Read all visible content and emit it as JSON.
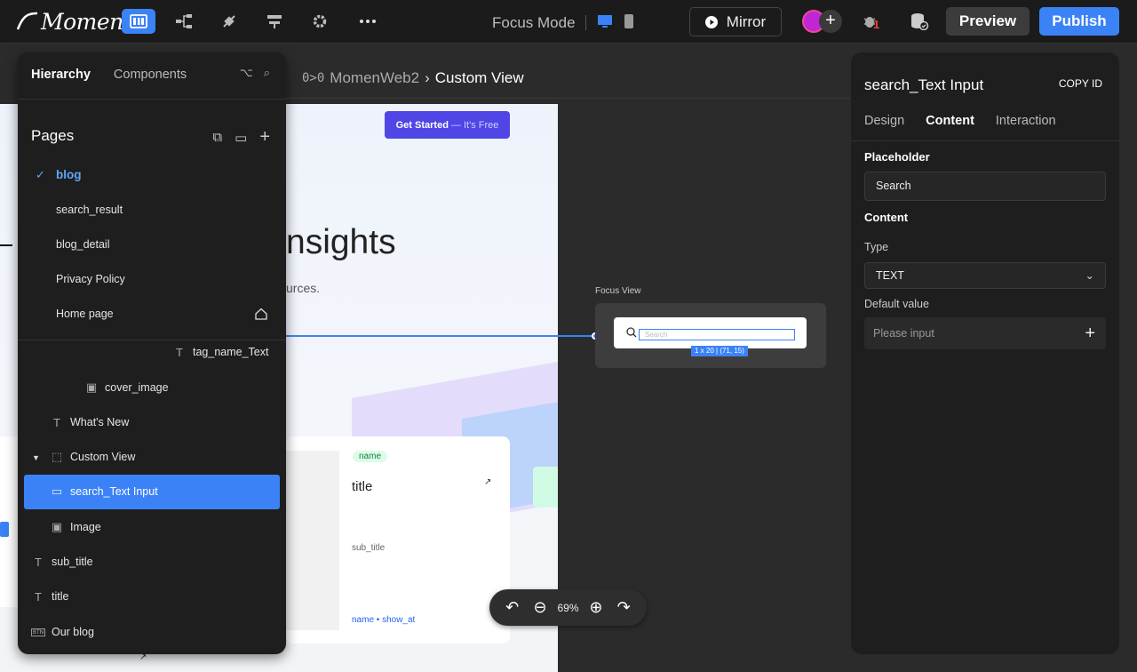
{
  "topbar": {
    "logo": "Momen",
    "focus_mode": "Focus Mode",
    "mirror": "Mirror",
    "bug_count": "1",
    "preview": "Preview",
    "publish": "Publish",
    "accent": "#3b82f6"
  },
  "breadcrumb": {
    "icon": "0>0",
    "app": "MomenWeb2",
    "page": "Custom View"
  },
  "canvas": {
    "get_started": "Get Started",
    "get_started_sub": "— It's Free",
    "hero_title": "nsights",
    "hero_sub": "urces.",
    "card": {
      "badge": "name",
      "title": "title",
      "subtitle": "sub_title",
      "meta": "name • show_at"
    }
  },
  "focus_view": {
    "label": "Focus View",
    "placeholder": "Search",
    "dimensions": "1 x 20 | (71, 15)"
  },
  "zoom": {
    "level": "69%"
  },
  "left_panel": {
    "tabs": [
      "Hierarchy",
      "Components"
    ],
    "pages_title": "Pages",
    "pages": [
      "blog",
      "search_result",
      "blog_detail",
      "Privacy Policy",
      "Home page"
    ],
    "tree": [
      "tag_name_Text",
      "cover_image",
      "What's New",
      "Custom View",
      "search_Text Input",
      "Image",
      "sub_title",
      "title",
      "Our blog"
    ]
  },
  "right_panel": {
    "title": "search_Text Input",
    "copy_id": "COPY ID",
    "tabs": [
      "Design",
      "Content",
      "Interaction"
    ],
    "placeholder_section": "Placeholder",
    "placeholder_value": "Search",
    "content_section": "Content",
    "type_label": "Type",
    "type_value": "TEXT",
    "default_label": "Default value",
    "default_placeholder": "Please input"
  }
}
